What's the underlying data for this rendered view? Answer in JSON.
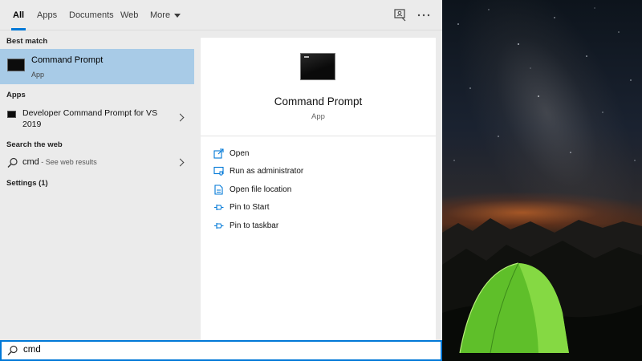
{
  "tabs": [
    {
      "label": "All",
      "active": true
    },
    {
      "label": "Apps"
    },
    {
      "label": "Documents"
    },
    {
      "label": "Web"
    },
    {
      "label": "More"
    }
  ],
  "sections": {
    "best_match": "Best match",
    "apps": "Apps",
    "search_web": "Search the web",
    "settings": "Settings (1)"
  },
  "best_match": {
    "name": "Command Prompt",
    "type": "App"
  },
  "apps": [
    {
      "name": "Developer Command Prompt for VS 2019"
    }
  ],
  "web": {
    "query": "cmd",
    "hint": " - See web results"
  },
  "detail": {
    "title": "Command Prompt",
    "type": "App",
    "actions": [
      {
        "label": "Open",
        "icon": "open-icon"
      },
      {
        "label": "Run as administrator",
        "icon": "shield-admin-icon"
      },
      {
        "label": "Open file location",
        "icon": "file-location-icon"
      },
      {
        "label": "Pin to Start",
        "icon": "pin-icon"
      },
      {
        "label": "Pin to taskbar",
        "icon": "pin-icon"
      }
    ]
  },
  "search_box": {
    "value": "cmd"
  },
  "colors": {
    "accent": "#0078d7",
    "selected_row": "#a8cbe7"
  }
}
